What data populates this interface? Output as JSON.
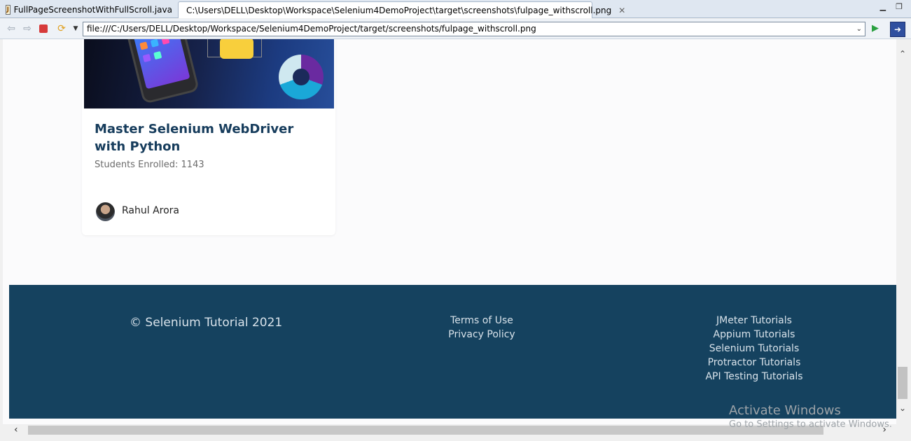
{
  "tabs": [
    {
      "label": "FullPageScreenshotWithFullScroll.java",
      "icon": "java-file-icon",
      "active": false
    },
    {
      "label": "C:\\Users\\DELL\\Desktop\\Workspace\\Selenium4DemoProject\\target\\screenshots\\fulpage_withscroll.png",
      "icon": "globe-icon",
      "active": true
    }
  ],
  "toolbar": {
    "url": "file:///C:/Users/DELL/Desktop/Workspace/Selenium4DemoProject/target/screenshots/fulpage_withscroll.png"
  },
  "card": {
    "title": "Master Selenium WebDriver with Python",
    "enrolled": "Students Enrolled: 1143",
    "author": "Rahul Arora"
  },
  "footer": {
    "copyright": "© Selenium Tutorial 2021",
    "links_mid": [
      "Terms of Use",
      "Privacy Policy"
    ],
    "links_right": [
      "JMeter Tutorials",
      "Appium Tutorials",
      "Selenium Tutorials",
      "Protractor Tutorials",
      "API Testing Tutorials"
    ],
    "background": "#15425f"
  },
  "watermark": {
    "title": "Activate Windows",
    "subtitle": "Go to Settings to activate Windows."
  },
  "colors": {
    "title": "#163c5c",
    "footer_text": "#d8e2ea"
  }
}
